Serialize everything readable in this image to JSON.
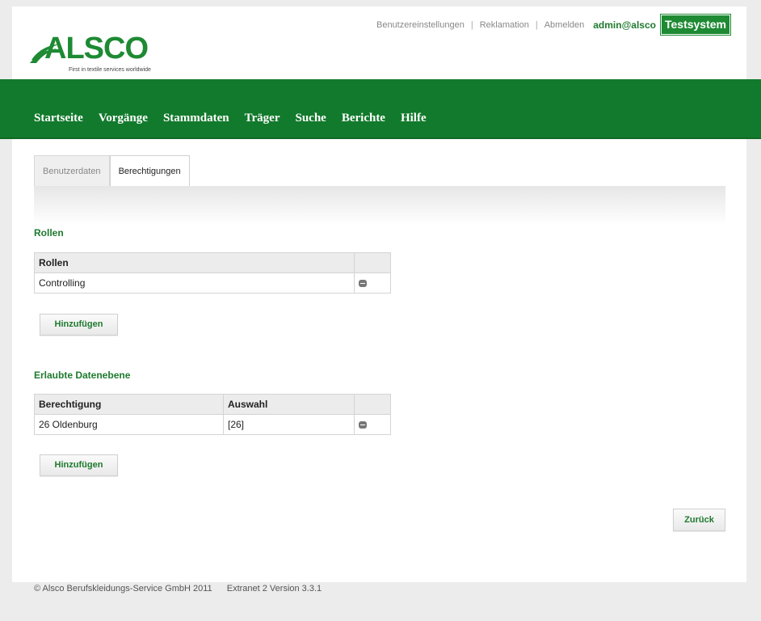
{
  "brand": {
    "logo_text": "ALSCO",
    "tagline": "First in textile services worldwide",
    "color": "#1e8a33"
  },
  "header": {
    "links": [
      "Benutzereinstellungen",
      "Reklamation",
      "Abmelden"
    ],
    "separator": "|",
    "user": "admin@alsco",
    "badge": "Testsystem"
  },
  "nav": {
    "items": [
      "Startseite",
      "Vorgänge",
      "Stammdaten",
      "Träger",
      "Suche",
      "Berichte",
      "Hilfe"
    ],
    "background": "#127a2c"
  },
  "tabs": [
    {
      "label": "Benutzerdaten",
      "active": false
    },
    {
      "label": "Berechtigungen",
      "active": true
    }
  ],
  "roles": {
    "title": "Rollen",
    "columns": [
      "Rollen",
      ""
    ],
    "rows": [
      [
        "Controlling"
      ]
    ],
    "add_label": "Hinzufügen",
    "remove_icon": "minus-circle-icon"
  },
  "data_levels": {
    "title": "Erlaubte Datenebene",
    "columns": [
      "Berechtigung",
      "Auswahl",
      ""
    ],
    "rows": [
      [
        "26 Oldenburg",
        "[26]"
      ]
    ],
    "add_label": "Hinzufügen",
    "remove_icon": "minus-circle-icon"
  },
  "back_label": "Zurück",
  "footer": {
    "copyright": "© Alsco Berufskleidungs-Service GmbH 2011",
    "version": "Extranet 2 Version 3.3.1"
  }
}
